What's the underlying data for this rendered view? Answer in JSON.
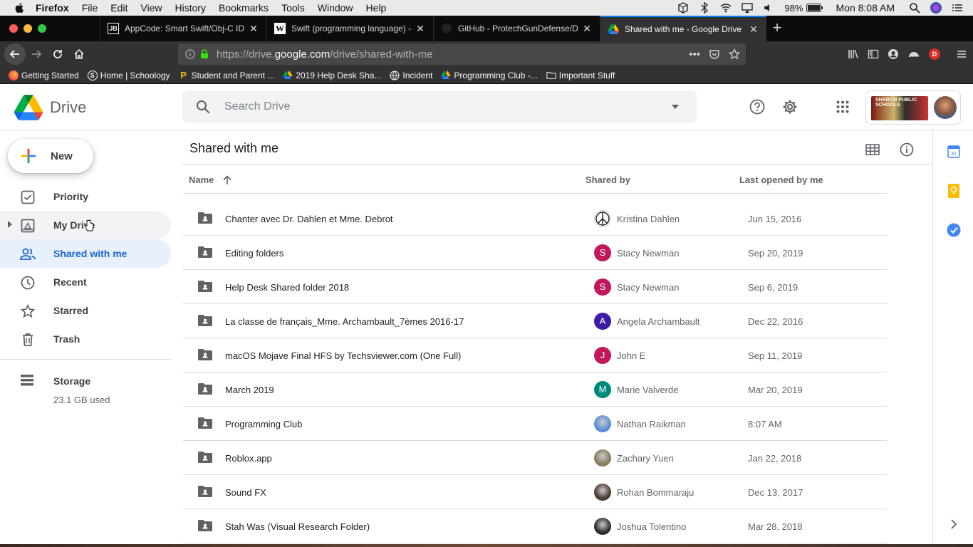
{
  "menubar": {
    "app": "Firefox",
    "items": [
      "File",
      "Edit",
      "View",
      "History",
      "Bookmarks",
      "Tools",
      "Window",
      "Help"
    ],
    "battery": "98%",
    "clock": "Mon 8:08 AM"
  },
  "tabs": [
    {
      "favicon": "JB",
      "title": "AppCode: Smart Swift/Obj-C ID",
      "active": false
    },
    {
      "favicon": "W",
      "title": "Swift (programming language) -",
      "active": false
    },
    {
      "favicon": "github-icon",
      "title": "GitHub - ProtechGunDefense/D",
      "active": false
    },
    {
      "favicon": "drive-icon",
      "title": "Shared with me - Google Drive",
      "active": true
    }
  ],
  "url": {
    "prefix": "https://drive.",
    "domain": "google.com",
    "suffix": "/drive/shared-with-me"
  },
  "bookmarks": [
    "Getting Started",
    "Home | Schoology",
    "Student and Parent ...",
    "2019 Help Desk Sha...",
    "Incident",
    "Programming Club -...",
    "Important Stuff"
  ],
  "drive": {
    "logo_text": "Drive",
    "search_placeholder": "Search Drive",
    "new_label": "New",
    "school_text": "SHARON PUBLIC SCHOOLS",
    "nav": [
      {
        "label": "Priority",
        "icon": "priority-check-icon",
        "active": false
      },
      {
        "label": "My Drive",
        "icon": "my-drive-icon",
        "active": false
      },
      {
        "label": "Shared with me",
        "icon": "shared-people-icon",
        "active": true
      },
      {
        "label": "Recent",
        "icon": "clock-icon",
        "active": false
      },
      {
        "label": "Starred",
        "icon": "star-icon",
        "active": false
      },
      {
        "label": "Trash",
        "icon": "trash-icon",
        "active": false
      }
    ],
    "storage": {
      "label": "Storage",
      "used": "23.1 GB used"
    },
    "page_title": "Shared with me",
    "columns": {
      "name": "Name",
      "shared_by": "Shared by",
      "last_opened": "Last opened by me"
    },
    "files": [
      {
        "name": "Chanter avec Dr. Dahlen et Mme. Debrot",
        "shared_by": "Kristina Dahlen",
        "avatar": "peace",
        "color": "#ffffff",
        "date": "Jun 15, 2016"
      },
      {
        "name": "Editing folders",
        "shared_by": "Stacy Newman",
        "avatar": "S",
        "color": "#c2185b",
        "date": "Sep 20, 2019"
      },
      {
        "name": "Help Desk Shared folder 2018",
        "shared_by": "Stacy Newman",
        "avatar": "S",
        "color": "#c2185b",
        "date": "Sep 6, 2019"
      },
      {
        "name": "La classe de français_Mme. Archambault_7èmes 2016-17",
        "shared_by": "Angela Archambault",
        "avatar": "A",
        "color": "#3f1ba5",
        "date": "Dec 22, 2016"
      },
      {
        "name": "macOS Mojave Final HFS by Techsviewer.com (One Full)",
        "shared_by": "John E",
        "avatar": "J",
        "color": "#c2185b",
        "date": "Sep 11, 2019"
      },
      {
        "name": "March 2019",
        "shared_by": "Marie Valverde",
        "avatar": "M",
        "color": "#00897b",
        "date": "Mar 20, 2019"
      },
      {
        "name": "Programming Club",
        "shared_by": "Nathan Raikman",
        "avatar": "",
        "color": "#5b8dd9",
        "date": "8:07 AM"
      },
      {
        "name": "Roblox.app",
        "shared_by": "Zachary Yuen",
        "avatar": "",
        "color": "#8a7a5a",
        "date": "Jan 22, 2018"
      },
      {
        "name": "Sound FX",
        "shared_by": "Rohan Bommaraju",
        "avatar": "",
        "color": "#4a3a30",
        "date": "Dec 13, 2017"
      },
      {
        "name": "Stah Was (Visual Research Folder)",
        "shared_by": "Joshua Tolentino",
        "avatar": "",
        "color": "#2a2a2a",
        "date": "Mar 28, 2018"
      }
    ]
  }
}
